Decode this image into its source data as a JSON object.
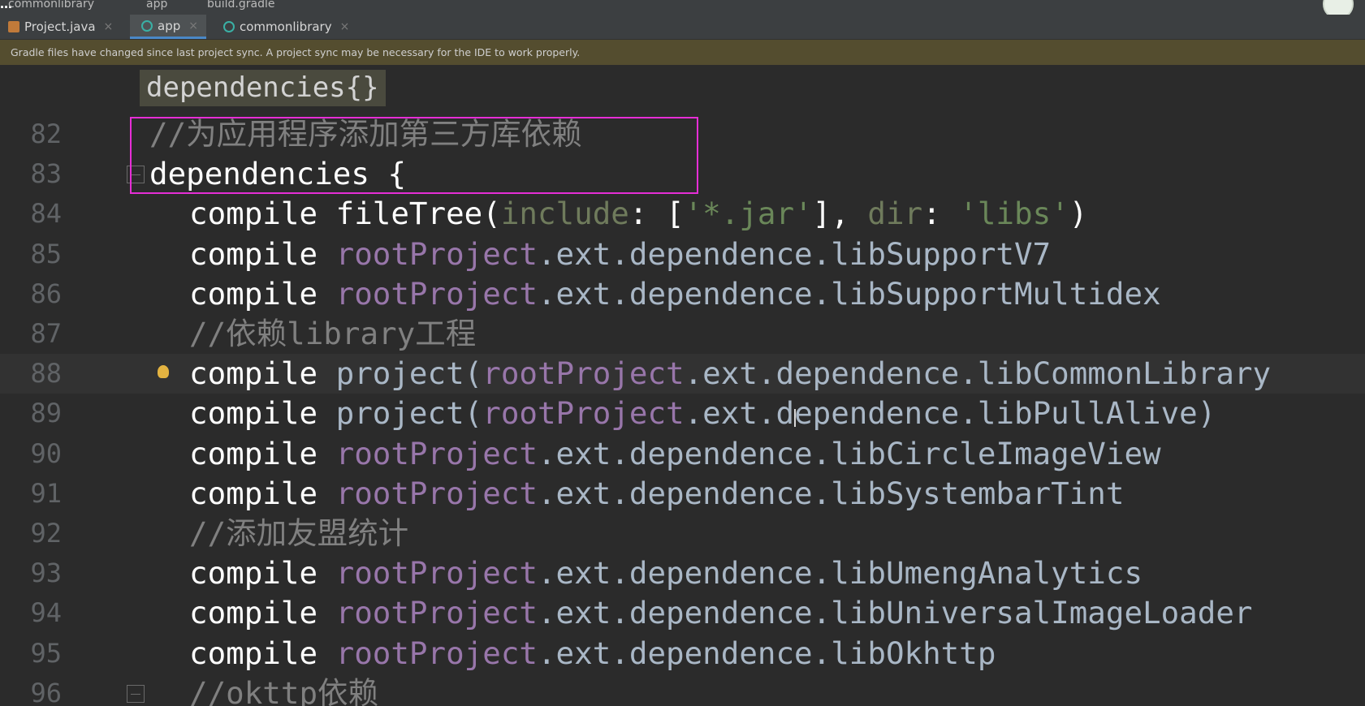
{
  "topbar": {
    "title_overlay": "…",
    "crumbs": [
      "commonlibrary",
      "app",
      "build.gradle"
    ]
  },
  "tabs": [
    {
      "label": "Project.java",
      "icon": "java-file-icon",
      "active": false
    },
    {
      "label": "app",
      "icon": "gradle-icon",
      "active": true
    },
    {
      "label": "commonlibrary",
      "icon": "gradle-icon",
      "active": false
    }
  ],
  "close_glyph": "×",
  "banner": {
    "text": "Gradle files have changed since last project sync. A project sync may be necessary for the IDE to work properly."
  },
  "breadcrumb_chip": "dependencies{}",
  "lines": [
    {
      "num": "82",
      "tokens": [
        {
          "t": "//为应用程序添加第三方库依赖",
          "c": "c-cm"
        }
      ]
    },
    {
      "num": "83",
      "tokens": [
        {
          "t": "dependencies {",
          "c": "c-kw"
        }
      ],
      "fold": true
    },
    {
      "num": "84",
      "tokens": [
        {
          "t": "compile ",
          "c": "c-kw"
        },
        {
          "t": "fileTree(",
          "c": "c-kw"
        },
        {
          "t": "include",
          "c": "c-named"
        },
        {
          "t": ": [",
          "c": "c-kw"
        },
        {
          "t": "'*.jar'",
          "c": "c-green"
        },
        {
          "t": "], ",
          "c": "c-kw"
        },
        {
          "t": "dir",
          "c": "c-named"
        },
        {
          "t": ": ",
          "c": "c-kw"
        },
        {
          "t": "'libs'",
          "c": "c-green"
        },
        {
          "t": ")",
          "c": "c-kw"
        }
      ]
    },
    {
      "num": "85",
      "tokens": [
        {
          "t": "compile ",
          "c": "c-kw"
        },
        {
          "t": "rootProject",
          "c": "c-purple"
        },
        {
          "t": ".ext.dependence.libSupportV7",
          "c": "c-gray"
        }
      ]
    },
    {
      "num": "86",
      "tokens": [
        {
          "t": "compile ",
          "c": "c-kw"
        },
        {
          "t": "rootProject",
          "c": "c-purple"
        },
        {
          "t": ".ext.dependence.libSupportMultidex",
          "c": "c-gray"
        }
      ]
    },
    {
      "num": "87",
      "tokens": [
        {
          "t": "//依赖library工程",
          "c": "c-cm"
        }
      ]
    },
    {
      "num": "88",
      "tokens": [
        {
          "t": "compile ",
          "c": "c-kw"
        },
        {
          "t": "project(",
          "c": "c-gray"
        },
        {
          "t": "rootProject",
          "c": "c-purple"
        },
        {
          "t": ".ext.dependence.libCommonLibrary",
          "c": "c-gray"
        }
      ],
      "caret": true,
      "bulb": true
    },
    {
      "num": "89",
      "tokens": [
        {
          "t": "compile ",
          "c": "c-kw"
        },
        {
          "t": "project(",
          "c": "c-gray"
        },
        {
          "t": "rootProject",
          "c": "c-purple"
        },
        {
          "t": ".ext.dependence.libPullAlive)",
          "c": "c-gray"
        }
      ]
    },
    {
      "num": "90",
      "tokens": [
        {
          "t": "compile ",
          "c": "c-kw"
        },
        {
          "t": "rootProject",
          "c": "c-purple"
        },
        {
          "t": ".ext.dependence.libCircleImageView",
          "c": "c-gray"
        }
      ]
    },
    {
      "num": "91",
      "tokens": [
        {
          "t": "compile ",
          "c": "c-kw"
        },
        {
          "t": "rootProject",
          "c": "c-purple"
        },
        {
          "t": ".ext.dependence.libSystembarTint",
          "c": "c-gray"
        }
      ]
    },
    {
      "num": "92",
      "tokens": [
        {
          "t": "//添加友盟统计",
          "c": "c-cm"
        }
      ]
    },
    {
      "num": "93",
      "tokens": [
        {
          "t": "compile ",
          "c": "c-kw"
        },
        {
          "t": "rootProject",
          "c": "c-purple"
        },
        {
          "t": ".ext.dependence.libUmengAnalytics",
          "c": "c-gray"
        }
      ]
    },
    {
      "num": "94",
      "tokens": [
        {
          "t": "compile ",
          "c": "c-kw"
        },
        {
          "t": "rootProject",
          "c": "c-purple"
        },
        {
          "t": ".ext.dependence.libUniversalImageLoader",
          "c": "c-gray"
        }
      ]
    },
    {
      "num": "95",
      "tokens": [
        {
          "t": "compile ",
          "c": "c-kw"
        },
        {
          "t": "rootProject",
          "c": "c-purple"
        },
        {
          "t": ".ext.dependence.libOkhttp",
          "c": "c-gray"
        }
      ]
    },
    {
      "num": "96",
      "tokens": [
        {
          "t": "//okttp依赖",
          "c": "c-cm"
        }
      ],
      "fold": true
    }
  ],
  "colors": {
    "editor_bg": "#2b2b2b",
    "highlight_box": "#e62ed6",
    "banner_bg": "#544d2f",
    "comment": "#808080",
    "purple": "#9876aa",
    "string": "#6a8759"
  }
}
